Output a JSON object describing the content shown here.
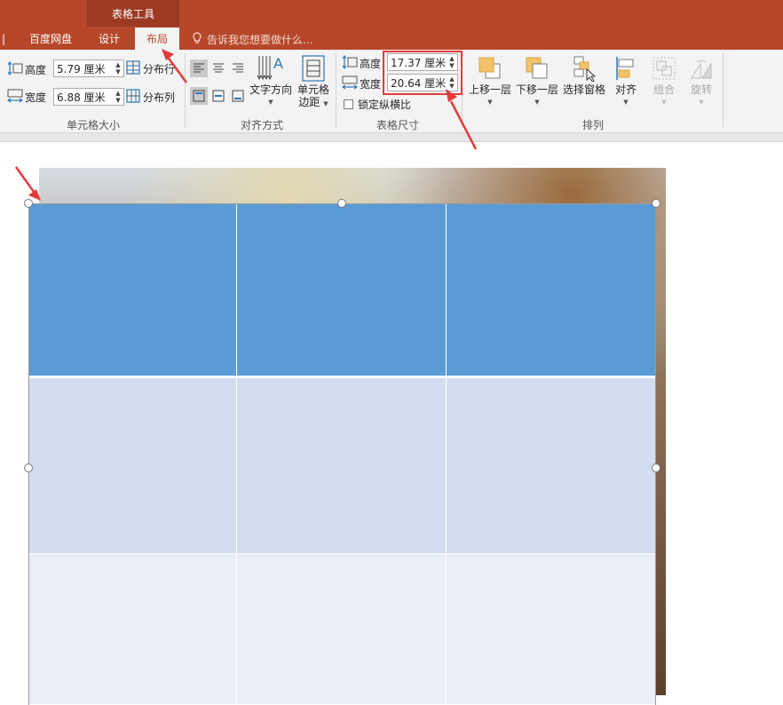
{
  "context_tab": "表格工具",
  "tabs": [
    {
      "label": "百度网盘",
      "active": false
    },
    {
      "label": "设计",
      "active": false
    },
    {
      "label": "布局",
      "active": true
    }
  ],
  "tell_me": "告诉我您想要做什么...",
  "cell_size": {
    "height_label": "高度",
    "height_value": "5.79 厘米",
    "width_label": "宽度",
    "width_value": "6.88 厘米",
    "distribute_rows": "分布行",
    "distribute_cols": "分布列",
    "group_label": "单元格大小"
  },
  "alignment": {
    "text_direction": "文字方向",
    "cell_margins_line1": "单元格",
    "cell_margins_line2": "边距",
    "group_label": "对齐方式"
  },
  "table_size": {
    "height_label": "高度",
    "height_value": "17.37 厘米",
    "width_label": "宽度",
    "width_value": "20.64 厘米",
    "lock_ratio": "锁定纵横比",
    "lock_ratio_checked": false,
    "group_label": "表格尺寸"
  },
  "arrange": {
    "bring_forward": "上移一层",
    "send_backward": "下移一层",
    "selection_pane": "选择窗格",
    "align": "对齐",
    "group": "组合",
    "rotate": "旋转",
    "group_label": "排列"
  },
  "colors": {
    "accent": "#b7472a",
    "header_fill": "#5b9bd5",
    "band_fill": "#d2deef",
    "light_fill": "#e9eef7",
    "annotation_red": "#e23b3b"
  }
}
